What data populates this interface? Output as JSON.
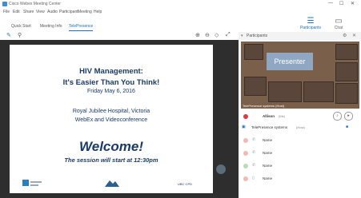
{
  "window": {
    "title": "Cisco Webex Meeting Center",
    "controls": [
      "—",
      "☐",
      "✕"
    ]
  },
  "menu": [
    "File",
    "Edit",
    "Share",
    "View",
    "Audio",
    "Participant",
    "Meeting",
    "Help"
  ],
  "tabs": [
    {
      "label": "Quick Start"
    },
    {
      "label": "Meeting Info"
    },
    {
      "label": "TelePresence",
      "active": true
    }
  ],
  "top_actions": {
    "participants": "Participants",
    "chat": "Chat"
  },
  "slide": {
    "title_line1": "HIV Management:",
    "title_line2": "It's Easier Than You Think!",
    "date": "Friday May 6, 2016",
    "location_line1": "Royal Jubilee Hospital, Victoria",
    "location_line2": "WebEx and Videoconference",
    "welcome": "Welcome!",
    "start_note": "The session will start at 12:30pm",
    "logo_right": "UBC CPD"
  },
  "panel": {
    "header": "Participants",
    "presenter_label": "Presenter",
    "video_caption": "TelePresence systems (Host)",
    "participants": [
      {
        "name": "Allison",
        "tag": "(Me)"
      },
      {
        "name": "TelePresence systems",
        "tag": "(Host)"
      },
      {
        "name": "Name",
        "tag": ""
      },
      {
        "name": "Name",
        "tag": ""
      },
      {
        "name": "Name",
        "tag": ""
      },
      {
        "name": "Name",
        "tag": ""
      }
    ]
  },
  "colors": {
    "accent": "#1e6fc0",
    "slide_text": "#1a3a6b",
    "stage_bg": "#2e2e2e",
    "presenter_box": "#8fa7c2"
  }
}
